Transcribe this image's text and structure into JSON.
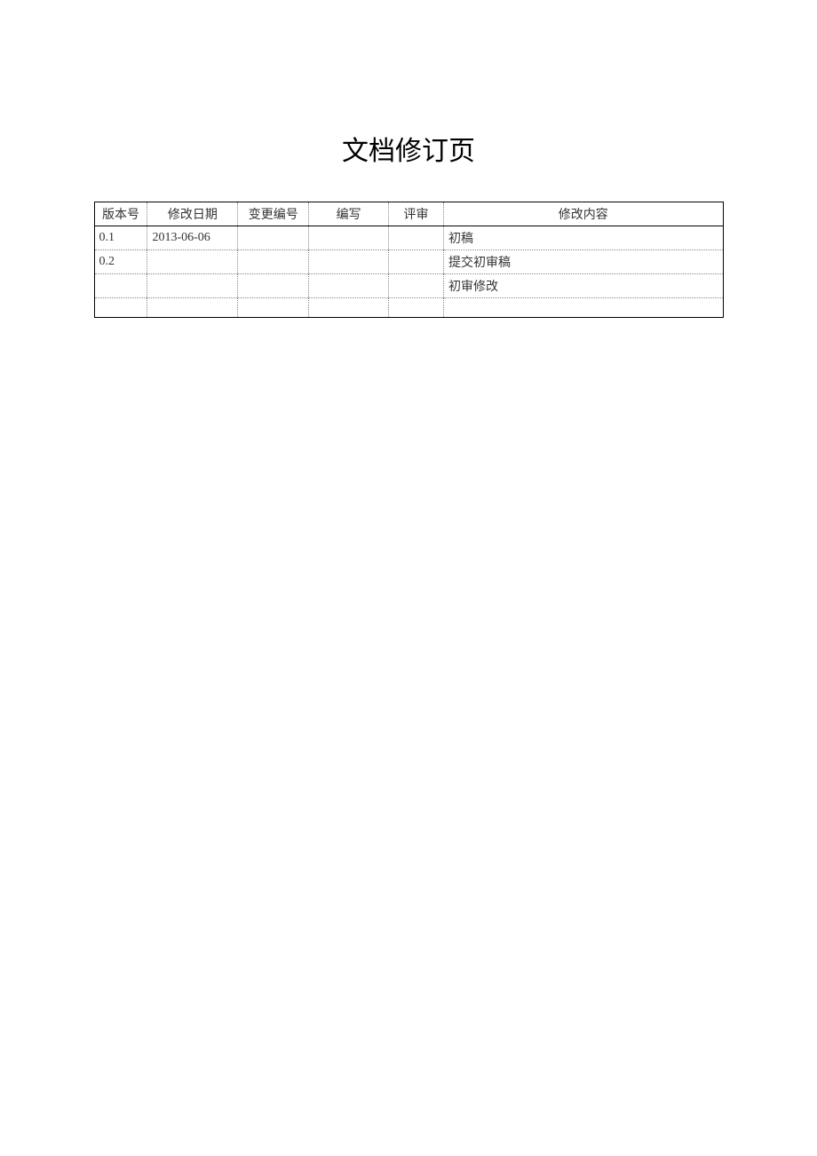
{
  "title": "文档修订页",
  "headers": {
    "version": "版本号",
    "date": "修改日期",
    "change_no": "变更编号",
    "author": "编写",
    "review": "评审",
    "content": "修改内容"
  },
  "rows": [
    {
      "version": "0.1",
      "date": "2013-06-06",
      "change_no": "",
      "author": "",
      "review": "",
      "content": "初稿",
      "content_blue": false
    },
    {
      "version": "0.2",
      "date": "",
      "change_no": "",
      "author": "",
      "review": "",
      "content": "提交初审稿",
      "content_blue": false
    },
    {
      "version": "",
      "date": "",
      "change_no": "",
      "author": "",
      "review": "",
      "content": "初审修改",
      "content_blue": true
    },
    {
      "version": "",
      "date": "",
      "change_no": "",
      "author": "",
      "review": "",
      "content": "",
      "content_blue": false
    }
  ]
}
